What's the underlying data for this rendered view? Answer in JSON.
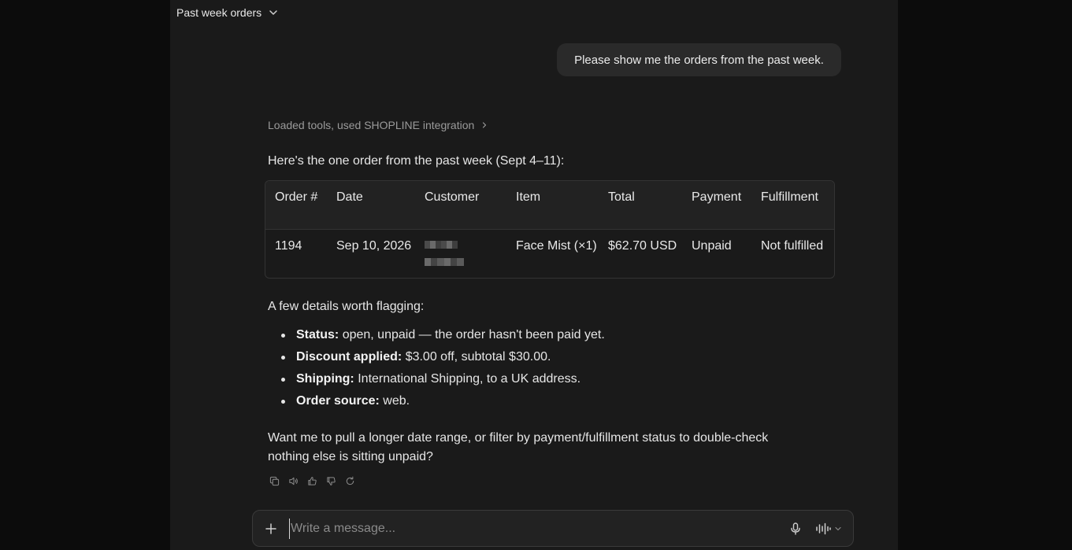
{
  "header": {
    "title": "Past week orders"
  },
  "user_message": "Please show me the orders from the past week.",
  "assistant": {
    "tools_status": "Loaded tools, used SHOPLINE integration",
    "intro": "Here's the one order from the past week (Sept 4–11):",
    "table": {
      "headers": [
        "Order #",
        "Date",
        "Customer",
        "Item",
        "Total",
        "Payment",
        "Fulfillment"
      ],
      "rows": [
        {
          "order": "1194",
          "date": "Sep 10, 2026",
          "customer": "",
          "item": "Face Mist (×1)",
          "total": "$62.70 USD",
          "payment": "Unpaid",
          "fulfillment": "Not fulfilled"
        }
      ]
    },
    "details_heading": "A few details worth flagging:",
    "details": [
      {
        "label": "Status:",
        "text": "open, unpaid — the order hasn't been paid yet."
      },
      {
        "label": "Discount applied:",
        "text": "$3.00 off, subtotal $30.00."
      },
      {
        "label": "Shipping:",
        "text": "International Shipping, to a UK address."
      },
      {
        "label": "Order source:",
        "text": "web."
      }
    ],
    "closing": "Want me to pull a longer date range, or filter by payment/fulfillment status to double-check nothing else is sitting unpaid?",
    "action_icons": [
      "copy-icon",
      "speaker-icon",
      "thumbs-up-icon",
      "thumbs-down-icon",
      "retry-icon"
    ]
  },
  "composer": {
    "placeholder": "Write a message..."
  },
  "colors": {
    "background": "#0c0c0c",
    "panel": "#1a1a1a",
    "bubble": "#2a2a2a",
    "text": "#e6e6e6",
    "muted": "#9a9a9a"
  }
}
